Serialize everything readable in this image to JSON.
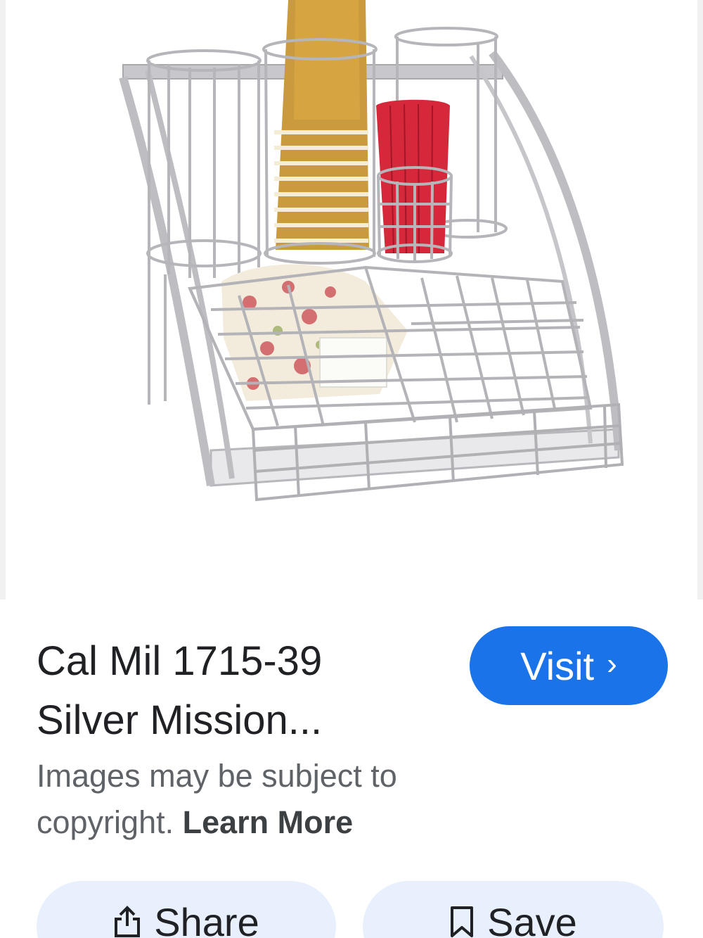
{
  "result": {
    "title_line1": "Cal Mil 1715-39",
    "title_line2": "Silver Mission...",
    "visit_label": "Visit",
    "visit_chevron": "›",
    "copyright_text": "Images may be subject to copyright.",
    "learn_more_label": "Learn More"
  },
  "actions": {
    "share_label": "Share",
    "save_label": "Save"
  },
  "icons": {
    "visit": "chevron-right-icon",
    "share": "share-icon",
    "save": "bookmark-icon"
  },
  "colors": {
    "accent": "#1a73e8",
    "action_bg": "#e8f0fe",
    "title_text": "#202124",
    "secondary_text": "#5f6368"
  }
}
